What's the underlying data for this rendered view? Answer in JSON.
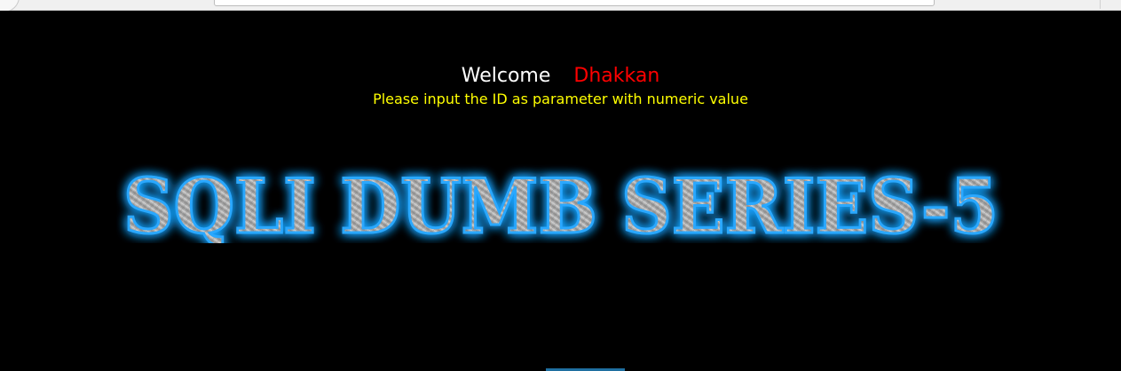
{
  "welcome": {
    "greeting": "Welcome",
    "name": "Dhakkan"
  },
  "instruction": "Please input the ID as parameter with numeric value",
  "banner": {
    "text": "SQLI DUMB SERIES-5"
  },
  "colors": {
    "background": "#000000",
    "greeting": "#ffffff",
    "name": "#ff0000",
    "instruction": "#ffff00",
    "banner_glow": "#1aa3ff",
    "banner_fill": "#9a9a9a"
  }
}
